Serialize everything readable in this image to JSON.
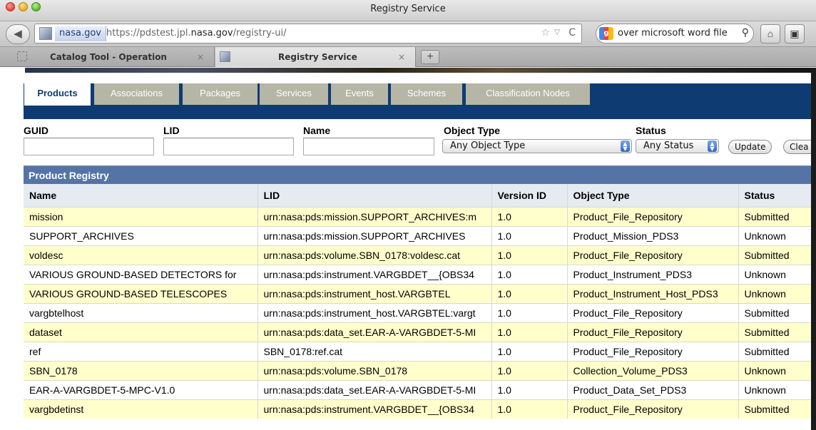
{
  "window": {
    "title": "Registry Service"
  },
  "toolbar": {
    "back_symbol": "◀",
    "identity": "nasa.gov",
    "url_prefix": "https://pdstest.jpl.",
    "url_domain": "nasa.gov",
    "url_suffix": "/registry-ui/",
    "star_symbol": "☆",
    "drop_symbol": "▽",
    "reload_symbol": "C",
    "search_value": "over microsoft word file",
    "search_symbol": "⚲",
    "home_symbol": "⌂",
    "ext_symbol": "▣"
  },
  "tabs": [
    {
      "label": "Catalog Tool - Operation",
      "close": "×"
    },
    {
      "label": "Registry Service",
      "close": "×"
    }
  ],
  "tab_add": "+",
  "nav_tabs": [
    "Products",
    "Associations",
    "Packages",
    "Services",
    "Events",
    "Schemes",
    "Classification Nodes"
  ],
  "filters": {
    "guid_label": "GUID",
    "lid_label": "LID",
    "name_label": "Name",
    "object_type_label": "Object Type",
    "object_type_value": "Any Object Type",
    "status_label": "Status",
    "status_value": "Any Status",
    "update_button": "Update",
    "clear_button": "Clea"
  },
  "registry": {
    "title": "Product Registry",
    "columns": [
      "Name",
      "LID",
      "Version ID",
      "Object Type",
      "Status"
    ],
    "rows": [
      [
        "mission",
        "urn:nasa:pds:mission.SUPPORT_ARCHIVES:m",
        "1.0",
        "Product_File_Repository",
        "Submitted"
      ],
      [
        "SUPPORT_ARCHIVES",
        "urn:nasa:pds:mission.SUPPORT_ARCHIVES",
        "1.0",
        "Product_Mission_PDS3",
        "Unknown"
      ],
      [
        "voldesc",
        "urn:nasa:pds:volume.SBN_0178:voldesc.cat",
        "1.0",
        "Product_File_Repository",
        "Submitted"
      ],
      [
        "VARIOUS GROUND-BASED DETECTORS for",
        "urn:nasa:pds:instrument.VARGBDET__{OBS34",
        "1.0",
        "Product_Instrument_PDS3",
        "Unknown"
      ],
      [
        "VARIOUS GROUND-BASED TELESCOPES",
        "urn:nasa:pds:instrument_host.VARGBTEL",
        "1.0",
        "Product_Instrument_Host_PDS3",
        "Unknown"
      ],
      [
        "vargbtelhost",
        "urn:nasa:pds:instrument_host.VARGBTEL:vargt",
        "1.0",
        "Product_File_Repository",
        "Submitted"
      ],
      [
        "dataset",
        "urn:nasa:pds:data_set.EAR-A-VARGBDET-5-MI",
        "1.0",
        "Product_File_Repository",
        "Submitted"
      ],
      [
        "ref",
        "SBN_0178:ref.cat",
        "1.0",
        "Product_File_Repository",
        "Submitted"
      ],
      [
        "SBN_0178",
        "urn:nasa:pds:volume.SBN_0178",
        "1.0",
        "Collection_Volume_PDS3",
        "Unknown"
      ],
      [
        "EAR-A-VARGBDET-5-MPC-V1.0",
        "urn:nasa:pds:data_set.EAR-A-VARGBDET-5-MI",
        "1.0",
        "Product_Data_Set_PDS3",
        "Unknown"
      ],
      [
        "vargbdetinst",
        "urn:nasa:pds:instrument.VARGBDET__{OBS34",
        "1.0",
        "Product_File_Repository",
        "Submitted"
      ]
    ]
  },
  "colors": {
    "header_band": "#0f3b73",
    "registry_header": "#5574a6",
    "odd_row": "#ffffcc",
    "inactive_tab": "#b6b6a6"
  }
}
